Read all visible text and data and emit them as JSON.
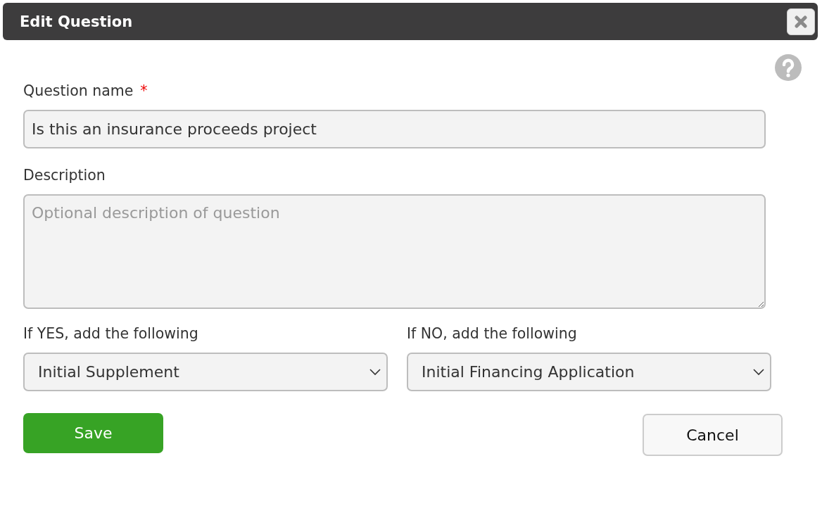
{
  "window": {
    "title": "Edit Question"
  },
  "fields": [
    {
      "label": "Question name",
      "required_mark": "*",
      "kind": "input",
      "value": "Is this an insurance proceeds project"
    },
    {
      "label": "Description",
      "kind": "textarea",
      "placeholder": "Optional description of question"
    }
  ],
  "branches": [
    {
      "label": "If YES, add the following",
      "value": "Initial Supplement"
    },
    {
      "label": "If NO, add the following",
      "value": "Initial Financing Application"
    }
  ],
  "buttons": [
    {
      "label": "Save",
      "kind": "primary"
    },
    {
      "label": "Cancel",
      "kind": "secondary"
    }
  ]
}
